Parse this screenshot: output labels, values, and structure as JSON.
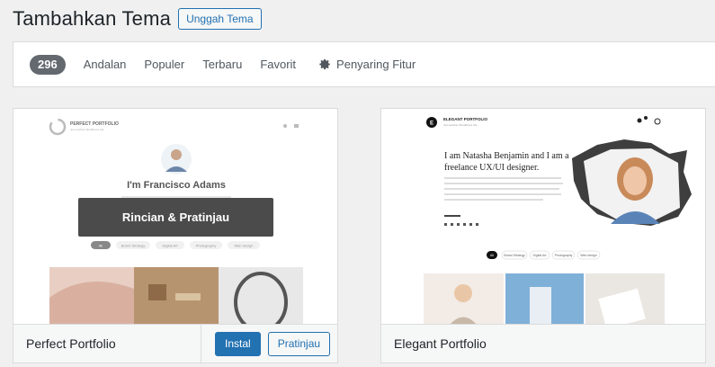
{
  "header": {
    "title": "Tambahkan Tema",
    "upload_label": "Unggah Tema"
  },
  "filter": {
    "count": "296",
    "tabs": [
      "Andalan",
      "Populer",
      "Terbaru",
      "Favorit"
    ],
    "feature_filter": "Penyaring Fitur"
  },
  "themes": [
    {
      "name": "Perfect Portfolio",
      "overlay_label": "Rincian & Pratinjau",
      "install_label": "Instal",
      "preview_label": "Pratinjau",
      "screenshot": {
        "brand": "PERFECT PORTFOLIO",
        "brand_sub": "Just another WordPress site",
        "hero": "I'm Francisco Adams",
        "chips": [
          "All",
          "Brand Strategy",
          "Digital Art",
          "Photography",
          "Web design"
        ]
      }
    },
    {
      "name": "Elegant Portfolio",
      "screenshot": {
        "brand": "ELEGANT PORTFOLIO",
        "brand_sub": "Just another WordPress site",
        "headline_1": "I am Natasha Benjamin and I am a",
        "headline_2": "freelance UX/UI designer.",
        "chips": [
          "All",
          "Brand Strategy",
          "Digital Art",
          "Photography",
          "Web design"
        ]
      }
    }
  ],
  "colors": {
    "accent": "#2271b1",
    "badge": "#646970",
    "overlay": "#323232"
  }
}
